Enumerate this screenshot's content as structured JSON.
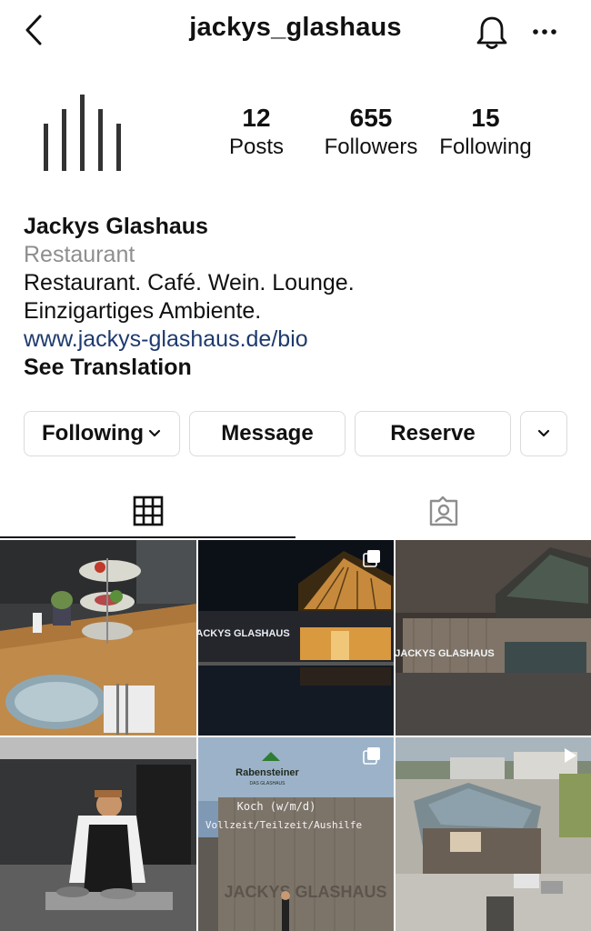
{
  "header": {
    "username": "jackys_glashaus",
    "icons": [
      "chevron-left-icon",
      "bell-icon",
      "more-icon"
    ]
  },
  "stats": [
    {
      "value": "12",
      "label": "Posts"
    },
    {
      "value": "655",
      "label": "Followers"
    },
    {
      "value": "15",
      "label": "Following"
    }
  ],
  "bio": {
    "name": "Jackys Glashaus",
    "category": "Restaurant",
    "line1": "Restaurant. Café. Wein. Lounge.",
    "line2": "Einzigartiges Ambiente.",
    "link": "www.jackys-glashaus.de/bio",
    "translate": "See Translation"
  },
  "buttons": {
    "following": "Following",
    "message": "Message",
    "reserve": "Reserve"
  },
  "tabs": [
    "grid-icon",
    "tagged-icon"
  ],
  "posts": {
    "p2_logo": "JACKYS GLASHAUS",
    "p3_logo": "JACKYS GLASHAUS",
    "p5_brand": "Rabensteiner",
    "p5_brand_sub": "DAS GLASHAUS",
    "p5_line1": "Koch (w/m/d)",
    "p5_line2": "Vollzeit/Teilzeit/Aushilfe",
    "p5_wall": "JACKYS GLASHAUS"
  },
  "colors": {
    "text": "#111111",
    "category": "#8e8e8e",
    "link": "#1e3a6e",
    "border": "#dbdbdb"
  }
}
